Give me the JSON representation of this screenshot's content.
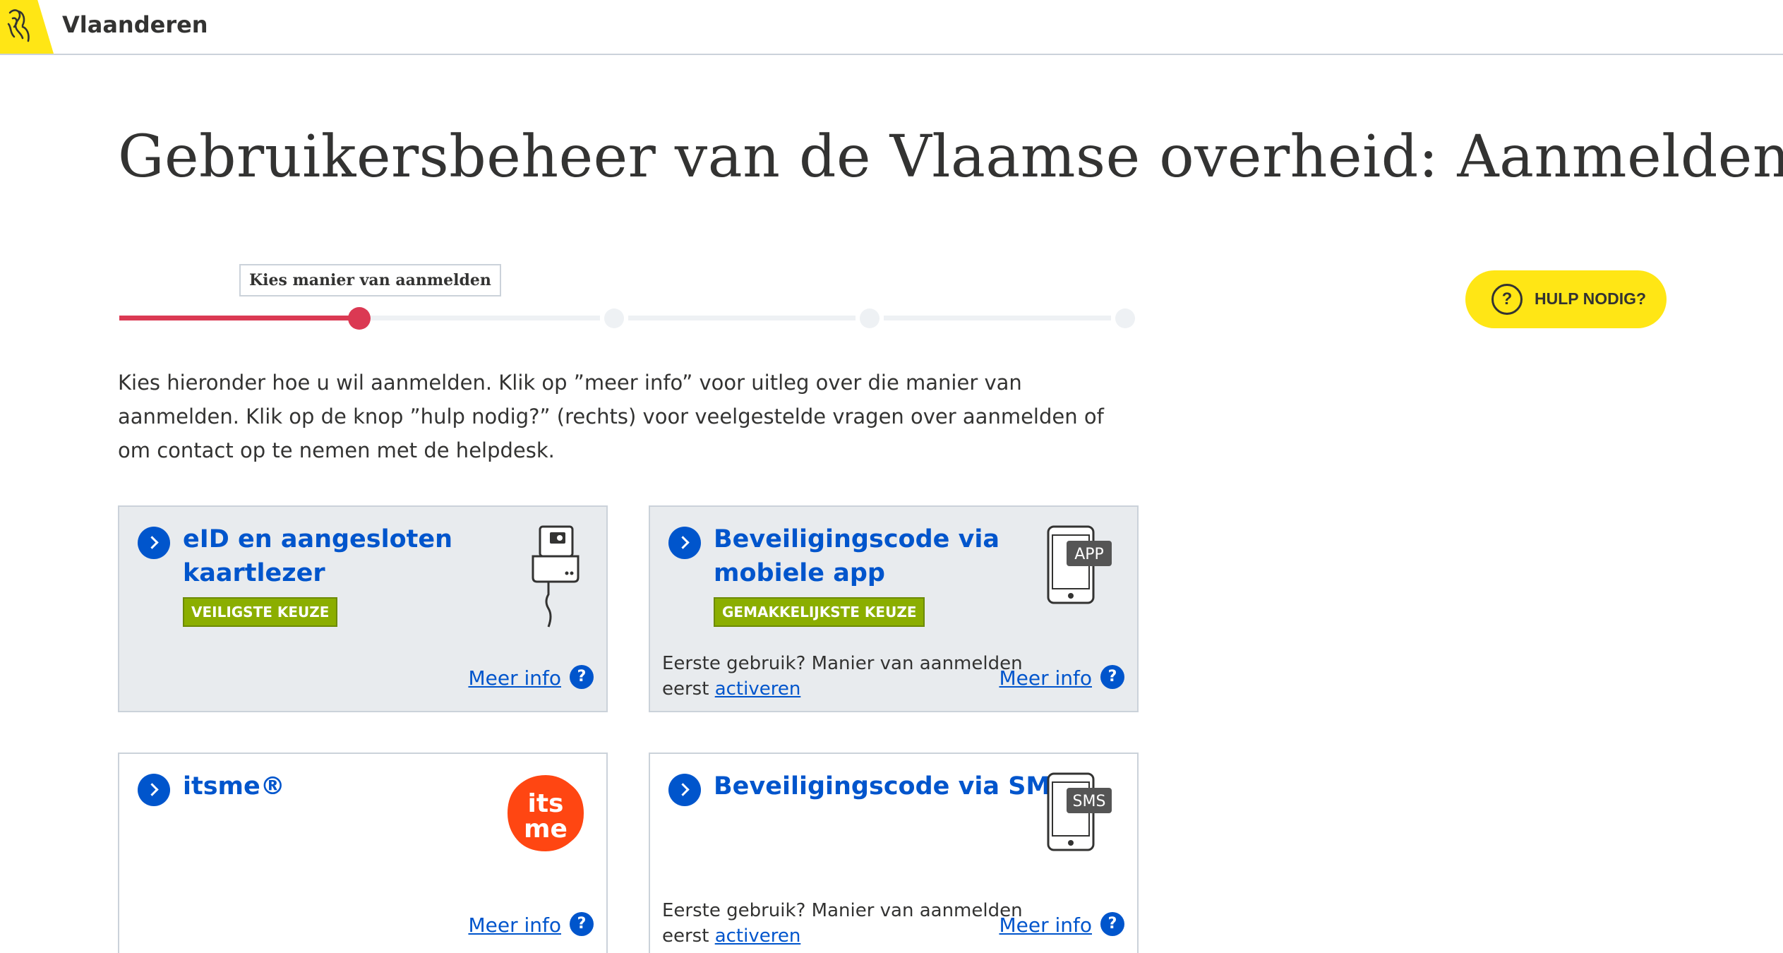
{
  "header": {
    "brand": "Vlaanderen"
  },
  "page": {
    "title": "Gebruikersbeheer van de Vlaamse overheid: Aanmelden"
  },
  "stepper": {
    "current_step_label": "Kies manier van aanmelden",
    "current_step": 2,
    "total_steps": 5
  },
  "help": {
    "label": "HULP NODIG?",
    "icon_glyph": "?"
  },
  "intro": "Kies hieronder hoe u wil aanmelden. Klik op ”meer info” voor uitleg over die manier van aanmelden. Klik op de knop ”hulp nodig?” (rechts) voor veelgestelde vragen over aanmelden of om contact op te nemen met de helpdesk.",
  "options": [
    {
      "title": "eID en aangesloten kaartlezer",
      "badge": "VEILIGSTE KEUZE",
      "meer_info": "Meer info",
      "icon": "card-reader-icon"
    },
    {
      "title": "Beveiligingscode via mobiele app",
      "badge": "GEMAKKELIJKSTE KEUZE",
      "first_use": "Eerste gebruik? Manier van aanmelden eerst",
      "activate": "activeren",
      "meer_info": "Meer info",
      "icon": "phone-app-icon",
      "icon_label": "APP"
    },
    {
      "title": "itsme®",
      "meer_info": "Meer info",
      "icon": "itsme-logo",
      "logo_text": "its me"
    },
    {
      "title": "Beveiligingscode via SMS",
      "first_use": "Eerste gebruik? Manier van aanmelden eerst",
      "activate": "activeren",
      "meer_info": "Meer info",
      "icon": "phone-sms-icon",
      "icon_label": "SMS"
    }
  ],
  "colors": {
    "brand_yellow": "#ffe615",
    "progress_red": "#db3953",
    "link_blue": "#0055cc",
    "badge_green": "#8bae00",
    "card_grey": "#e8ebee"
  }
}
